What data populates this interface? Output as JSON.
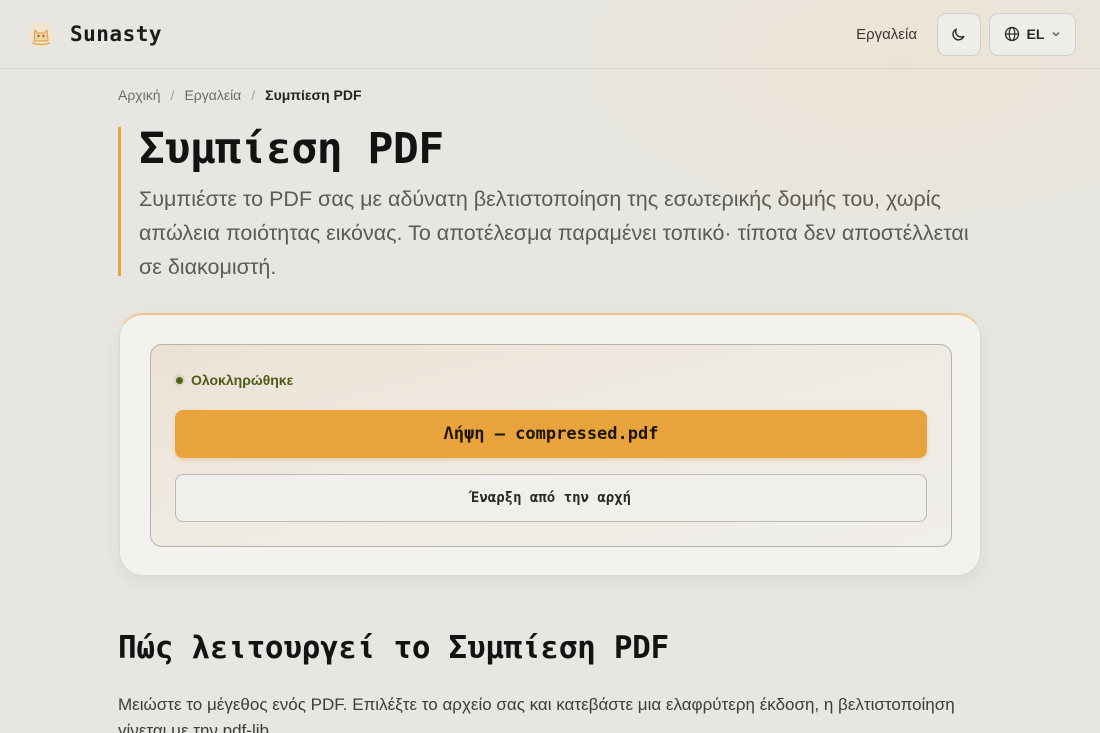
{
  "header": {
    "brand": "Sunasty",
    "nav_tools": "Εργαλεία",
    "lang_code": "EL",
    "icons": {
      "logo": "cat-logo-icon",
      "theme": "moon-icon",
      "lang": "globe-icon",
      "lang_caret": "chevron-down-icon"
    }
  },
  "breadcrumb": {
    "home": "Αρχική",
    "tools": "Εργαλεία",
    "current": "Συμπίεση PDF",
    "separator": "/"
  },
  "hero": {
    "title": "Συμπίεση PDF",
    "description": "Συμπιέστε το PDF σας με αδύνατη βελτιστοποίηση της εσωτερικής δομής του, χωρίς απώλεια ποιότητας εικόνας. Το αποτέλεσμα παραμένει τοπικό· τίποτα δεν αποστέλλεται σε διακομιστή."
  },
  "result_card": {
    "status": "Ολοκληρώθηκε",
    "download_label": "Λήψη — compressed.pdf",
    "restart_label": "Έναρξη από την αρχή"
  },
  "how_it_works": {
    "title": "Πώς λειτουργεί το Συμπίεση PDF",
    "text": "Μειώστε το μέγεθος ενός PDF. Επιλέξτε το αρχείο σας και κατεβάστε μια ελαφρύτερη έκδοση, η βελτιστοποίηση γίνεται με την pdf-lib."
  },
  "colors": {
    "accent": "#e9a33d",
    "background": "#e8e6e2",
    "success": "#55621a"
  }
}
